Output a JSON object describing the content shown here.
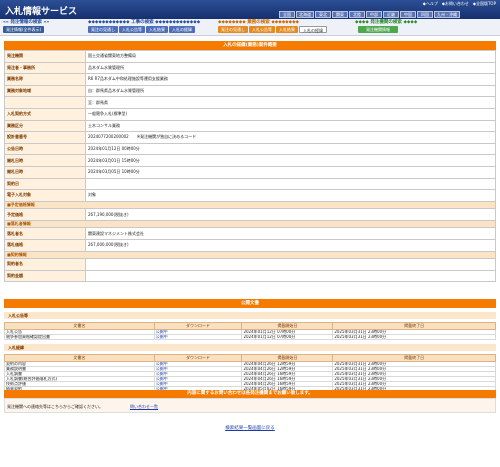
{
  "header": {
    "logo": "入札情報サービス",
    "links": [
      "◆ヘルプ",
      "◆お問い合わせ",
      "◆全国版TOP"
    ],
    "regions": [
      "全国",
      "北海道",
      "東北",
      "関東",
      "北陸",
      "中部",
      "近畿",
      "中国",
      "四国",
      "九州・沖縄"
    ]
  },
  "nav": {
    "g1": {
      "caption": "«« 発注情報の検索 »»",
      "buttons": [
        "発注情報(全件表示)"
      ]
    },
    "g2": {
      "caption": "◆◆◆◆◆◆◆◆◆◆◆◆ 工事の検索 ◆◆◆◆◆◆◆◆◆◆◆◆◆",
      "buttons": [
        "発注の見通し",
        "入札公告等",
        "入札結果",
        "入札の経緯"
      ]
    },
    "g3": {
      "caption": "◆◆◆◆◆◆◆◆ 業務の検索 ◆◆◆◆◆◆◆◆",
      "buttons": [
        "発注の見通し",
        "入札公告等",
        "入札結果",
        "入札の経緯"
      ]
    },
    "g4": {
      "caption": "◆◆◆◆ 発注機関の検索 ◆◆◆◆",
      "buttons": [
        "発注機関情報"
      ]
    }
  },
  "section1": {
    "title": "入札の経緯(業務)案件概要",
    "rows": [
      {
        "k": "発注機関",
        "v": "国土交通省関東地方整備局"
      },
      {
        "k": "発注者・事務所",
        "v": "品木ダム水質管理所"
      },
      {
        "k": "業務名称",
        "v": "R6 R7品木ダム中和処理施設等運用支援業務"
      },
      {
        "k": "業務対象地域",
        "v": "自：群馬県品木ダム水質管理所"
      },
      {
        "k": "",
        "v": "至：群馬県"
      },
      {
        "k": "入札契約方式",
        "v": "一般競争入札(標準型)"
      },
      {
        "k": "業務区分",
        "v": "土木コンサル業務"
      },
      {
        "k": "設計書番号",
        "v": "2024077200200002　　※発注機関が独自に決めるコード"
      },
      {
        "k": "公告日時",
        "v": "2024年01月12日 00時00分"
      },
      {
        "k": "開札日時",
        "v": "2024年03月01日 15時00分"
      },
      {
        "k": "開札日時",
        "v": "2024年03月05日 10時00分"
      },
      {
        "k": "契約日",
        "v": ""
      },
      {
        "k": "電子入札対象",
        "v": "対象"
      },
      {
        "sub": "■予定価格情報"
      },
      {
        "k": "予定価格",
        "v": "267,190,000(税抜き)"
      },
      {
        "sub": "■落札者情報"
      },
      {
        "k": "落札者名",
        "v": "関東建設マネジメント株式会社"
      },
      {
        "k": "落札価格",
        "v": "267,000,000(税抜き)"
      },
      {
        "sub": "■契約情報"
      },
      {
        "k": "契約者名",
        "v": ""
      },
      {
        "k": "契約金額",
        "v": ""
      }
    ]
  },
  "section2": {
    "title": "公開文書",
    "headers": [
      "文書名",
      "ダウンロード",
      "掲載開始日",
      "掲載終了日"
    ],
    "g1": {
      "label": "入札公告等",
      "rows": [
        [
          "入札公告",
          "公開中",
          "2024年01月12日 07時00分",
          "2025年03月31日 23時00分"
        ],
        [
          "競争参加資格確認提出書",
          "公開中",
          "2024年01月12日 07時00分",
          "2025年03月31日 23時00分"
        ]
      ]
    },
    "g2": {
      "label": "入札経緯",
      "rows": [
        [
          "契約の内容",
          "公開中",
          "2024年04月26日 12時59分",
          "2025年03月31日 23時00分"
        ],
        [
          "業務説明書",
          "公開中",
          "2024年04月26日 12時59分",
          "2025年03月31日 23時00分"
        ],
        [
          "入札調書",
          "公開中",
          "2024年04月26日 16時59分",
          "2025年03月31日 23時00分"
        ],
        [
          "入札調書(総合評価落札方式)",
          "公開中",
          "2024年04月26日 16時59分",
          "2025年03月31日 23時00分"
        ],
        [
          "技術点評価",
          "公開中",
          "2024年04月26日 16時59分",
          "2025年03月31日 23時00分"
        ],
        [
          "随意契約",
          "公開中",
          "2024年05月02日 16時59分",
          "2025年03月31日 23時00分"
        ]
      ]
    }
  },
  "contact": {
    "title": "内容に関するお問い合わせは各発注機関までお願い致します。",
    "text": "発注機関への連絡先等はこちらからご確認ください。",
    "link": "問い合わせ一覧"
  },
  "back": "検索結果一覧画面に戻る"
}
